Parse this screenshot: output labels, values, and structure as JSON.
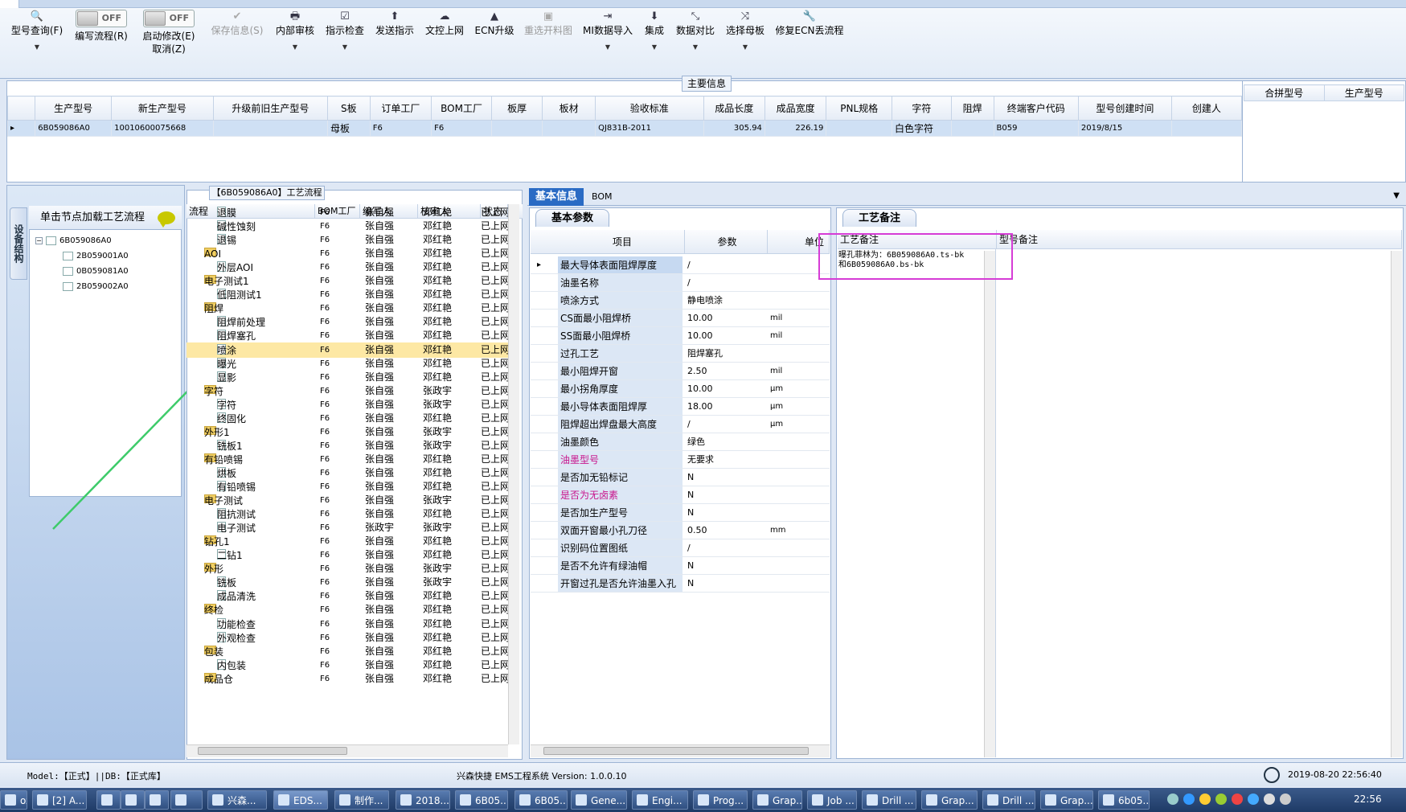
{
  "ribbon": {
    "buttons": [
      {
        "label": "型号查询(F)",
        "icon": "search-icon",
        "has_dropdown": true
      },
      {
        "label": "编写流程(R)",
        "icon": "toggle-off",
        "toggle_text": "OFF"
      },
      {
        "label": "启动修改(E)",
        "sub_label": "取消(Z)",
        "icon": "toggle-off",
        "toggle_text": "OFF"
      },
      {
        "label": "保存信息(S)",
        "icon": "check-icon",
        "disabled": true
      },
      {
        "label": "内部审核",
        "icon": "printer-icon",
        "has_dropdown": true
      },
      {
        "label": "指示检查",
        "icon": "checkbox-icon",
        "has_dropdown": true
      },
      {
        "label": "发送指示",
        "icon": "upload-icon"
      },
      {
        "label": "文控上网",
        "icon": "cloud-upload-icon"
      },
      {
        "label": "ECN升级",
        "icon": "ecn-icon"
      },
      {
        "label": "重选开料图",
        "icon": "image-icon",
        "disabled": true
      },
      {
        "label": "MI数据导入",
        "icon": "import-icon",
        "has_dropdown": true
      },
      {
        "label": "集成",
        "icon": "download-icon",
        "has_dropdown": true
      },
      {
        "label": "数据对比",
        "icon": "compare-icon",
        "has_dropdown": true
      },
      {
        "label": "选择母板",
        "icon": "shuffle-icon",
        "has_dropdown": true
      },
      {
        "label": "修复ECN丢流程",
        "icon": "wrench-icon"
      }
    ]
  },
  "main_info": {
    "caption": "主要信息",
    "columns": [
      "生产型号",
      "新生产型号",
      "升级前旧生产型号",
      "S板",
      "订单工厂",
      "BOM工厂",
      "板厚",
      "板材",
      "验收标准",
      "成品长度",
      "成品宽度",
      "PNL规格",
      "字符",
      "阻焊",
      "终端客户代码",
      "型号创建时间",
      "创建人"
    ],
    "rows": [
      [
        "6B059086A0",
        "10010600075668",
        "",
        "母板",
        "F6",
        "F6",
        "",
        "",
        "QJ831B-2011",
        "305.94",
        "226.19",
        "",
        "白色字符",
        "",
        "B059",
        "2019/8/15",
        ""
      ]
    ],
    "side_columns": [
      "合拼型号",
      "生产型号"
    ]
  },
  "left_panel": {
    "vertical_tab": "设备结构",
    "header": "单击节点加载工艺流程",
    "tree": {
      "root": "6B059086A0",
      "children": [
        "2B059001A0",
        "0B059081A0",
        "2B059002A0"
      ]
    }
  },
  "flow": {
    "caption": "【6B059086A0】工艺流程",
    "columns": [
      "流程",
      "BOM工厂",
      "编写人",
      "核审人",
      "状态"
    ],
    "rows": [
      {
        "name": "退膜",
        "level": 2,
        "bom": "F6",
        "writer": "张自强",
        "reviewer": "邓红艳",
        "status": "已上网"
      },
      {
        "name": "碱性蚀刻",
        "level": 2,
        "bom": "F6",
        "writer": "张自强",
        "reviewer": "邓红艳",
        "status": "已上网"
      },
      {
        "name": "退锡",
        "level": 2,
        "bom": "F6",
        "writer": "张自强",
        "reviewer": "邓红艳",
        "status": "已上网"
      },
      {
        "name": "AOI",
        "level": 1,
        "bom": "F6",
        "writer": "张自强",
        "reviewer": "邓红艳",
        "status": "已上网"
      },
      {
        "name": "外层AOI",
        "level": 2,
        "bom": "F6",
        "writer": "张自强",
        "reviewer": "邓红艳",
        "status": "已上网"
      },
      {
        "name": "电子测试1",
        "level": 1,
        "bom": "F6",
        "writer": "张自强",
        "reviewer": "邓红艳",
        "status": "已上网"
      },
      {
        "name": "低阻测试1",
        "level": 2,
        "bom": "F6",
        "writer": "张自强",
        "reviewer": "邓红艳",
        "status": "已上网"
      },
      {
        "name": "阻焊",
        "level": 1,
        "bom": "F6",
        "writer": "张自强",
        "reviewer": "邓红艳",
        "status": "已上网"
      },
      {
        "name": "阻焊前处理",
        "level": 2,
        "bom": "F6",
        "writer": "张自强",
        "reviewer": "邓红艳",
        "status": "已上网"
      },
      {
        "name": "阻焊塞孔",
        "level": 2,
        "bom": "F6",
        "writer": "张自强",
        "reviewer": "邓红艳",
        "status": "已上网"
      },
      {
        "name": "喷涂",
        "level": 2,
        "bom": "F6",
        "writer": "张自强",
        "reviewer": "邓红艳",
        "status": "已上网",
        "selected": true
      },
      {
        "name": "曝光",
        "level": 2,
        "bom": "F6",
        "writer": "张自强",
        "reviewer": "邓红艳",
        "status": "已上网"
      },
      {
        "name": "显影",
        "level": 2,
        "bom": "F6",
        "writer": "张自强",
        "reviewer": "邓红艳",
        "status": "已上网"
      },
      {
        "name": "字符",
        "level": 1,
        "bom": "F6",
        "writer": "张自强",
        "reviewer": "张政宇",
        "status": "已上网"
      },
      {
        "name": "字符",
        "level": 2,
        "bom": "F6",
        "writer": "张自强",
        "reviewer": "张政宇",
        "status": "已上网"
      },
      {
        "name": "终固化",
        "level": 2,
        "bom": "F6",
        "writer": "张自强",
        "reviewer": "邓红艳",
        "status": "已上网"
      },
      {
        "name": "外形1",
        "level": 1,
        "bom": "F6",
        "writer": "张自强",
        "reviewer": "张政宇",
        "status": "已上网"
      },
      {
        "name": "铣板1",
        "level": 2,
        "bom": "F6",
        "writer": "张自强",
        "reviewer": "张政宇",
        "status": "已上网"
      },
      {
        "name": "有铅喷锡",
        "level": 1,
        "bom": "F6",
        "writer": "张自强",
        "reviewer": "邓红艳",
        "status": "已上网"
      },
      {
        "name": "烘板",
        "level": 2,
        "bom": "F6",
        "writer": "张自强",
        "reviewer": "邓红艳",
        "status": "已上网"
      },
      {
        "name": "有铅喷锡",
        "level": 2,
        "bom": "F6",
        "writer": "张自强",
        "reviewer": "邓红艳",
        "status": "已上网"
      },
      {
        "name": "电子测试",
        "level": 1,
        "bom": "F6",
        "writer": "张自强",
        "reviewer": "张政宇",
        "status": "已上网"
      },
      {
        "name": "阻抗测试",
        "level": 2,
        "bom": "F6",
        "writer": "张自强",
        "reviewer": "邓红艳",
        "status": "已上网"
      },
      {
        "name": "电子测试",
        "level": 2,
        "bom": "F6",
        "writer": "张政宇",
        "reviewer": "张政宇",
        "status": "已上网"
      },
      {
        "name": "钻孔1",
        "level": 1,
        "bom": "F6",
        "writer": "张自强",
        "reviewer": "邓红艳",
        "status": "已上网"
      },
      {
        "name": "二钻1",
        "level": 2,
        "bom": "F6",
        "writer": "张自强",
        "reviewer": "邓红艳",
        "status": "已上网"
      },
      {
        "name": "外形",
        "level": 1,
        "bom": "F6",
        "writer": "张自强",
        "reviewer": "张政宇",
        "status": "已上网"
      },
      {
        "name": "铣板",
        "level": 2,
        "bom": "F6",
        "writer": "张自强",
        "reviewer": "张政宇",
        "status": "已上网"
      },
      {
        "name": "成品清洗",
        "level": 2,
        "bom": "F6",
        "writer": "张自强",
        "reviewer": "邓红艳",
        "status": "已上网"
      },
      {
        "name": "终检",
        "level": 1,
        "bom": "F6",
        "writer": "张自强",
        "reviewer": "邓红艳",
        "status": "已上网"
      },
      {
        "name": "功能检查",
        "level": 2,
        "bom": "F6",
        "writer": "张自强",
        "reviewer": "邓红艳",
        "status": "已上网"
      },
      {
        "name": "外观检查",
        "level": 2,
        "bom": "F6",
        "writer": "张自强",
        "reviewer": "邓红艳",
        "status": "已上网"
      },
      {
        "name": "包装",
        "level": 1,
        "bom": "F6",
        "writer": "张自强",
        "reviewer": "邓红艳",
        "status": "已上网"
      },
      {
        "name": "内包装",
        "level": 2,
        "bom": "F6",
        "writer": "张自强",
        "reviewer": "邓红艳",
        "status": "已上网"
      },
      {
        "name": "成品仓",
        "level": 1,
        "bom": "F6",
        "writer": "张自强",
        "reviewer": "邓红艳",
        "status": "已上网"
      }
    ]
  },
  "basic": {
    "tabs": [
      "基本信息",
      "BOM"
    ],
    "params_tab": "基本参数",
    "columns": [
      "项目",
      "参数",
      "单位"
    ],
    "rows": [
      {
        "name": "最大导体表面阻焊厚度",
        "value": "/",
        "unit": "",
        "selected": true
      },
      {
        "name": "油墨名称",
        "value": "/",
        "unit": ""
      },
      {
        "name": "喷涂方式",
        "value": "静电喷涂",
        "unit": ""
      },
      {
        "name": "CS面最小阻焊桥",
        "value": "10.00",
        "unit": "mil"
      },
      {
        "name": "SS面最小阻焊桥",
        "value": "10.00",
        "unit": "mil"
      },
      {
        "name": "过孔工艺",
        "value": "阻焊塞孔",
        "unit": ""
      },
      {
        "name": "最小阻焊开窗",
        "value": "2.50",
        "unit": "mil"
      },
      {
        "name": "最小拐角厚度",
        "value": "10.00",
        "unit": "μm"
      },
      {
        "name": "最小导体表面阻焊厚",
        "value": "18.00",
        "unit": "μm"
      },
      {
        "name": "阻焊超出焊盘最大高度",
        "value": "/",
        "unit": "μm"
      },
      {
        "name": "油墨颜色",
        "value": "绿色",
        "unit": ""
      },
      {
        "name": "油墨型号",
        "value": "无要求",
        "unit": "",
        "highlight": true
      },
      {
        "name": "是否加无铅标记",
        "value": "N",
        "unit": ""
      },
      {
        "name": "是否为无卤素",
        "value": "N",
        "unit": "",
        "highlight": true
      },
      {
        "name": "是否加生产型号",
        "value": "N",
        "unit": ""
      },
      {
        "name": "双面开窗最小孔刀径",
        "value": "0.50",
        "unit": "mm"
      },
      {
        "name": "识别码位置图纸",
        "value": "/",
        "unit": ""
      },
      {
        "name": "是否不允许有绿油帽",
        "value": "N",
        "unit": ""
      },
      {
        "name": "开窗过孔是否允许油墨入孔",
        "value": "N",
        "unit": ""
      }
    ]
  },
  "remarks": {
    "tab": "工艺备注",
    "columns": [
      "工艺备注",
      "型号备注"
    ],
    "process_note": "曝孔菲林为：6B059086A0.ts-bk\n和6B059086A0.bs-bk"
  },
  "status": {
    "model": "Model:【正式】||DB:【正式库】",
    "app": "兴森快捷 EMS工程系统 Version: 1.0.0.10",
    "datetime": "2019-08-20 22:56:40"
  },
  "taskbar": {
    "items": [
      "oxm...",
      "[2] A...",
      "",
      "",
      "",
      "",
      "兴森...",
      "EDS...",
      "制作...",
      "2018...",
      "6B05...",
      "6B05...",
      "Gene...",
      "Engi...",
      "Prog...",
      "Grap...",
      "Job ...",
      "Drill ...",
      "Grap...",
      "Drill ...",
      "Grap...",
      "6b05..."
    ],
    "clock": "22:56"
  },
  "colors": {
    "highlight_box": "#d63cd6",
    "selected_row": "#fde8a4",
    "accent": "#1f5aa8"
  }
}
